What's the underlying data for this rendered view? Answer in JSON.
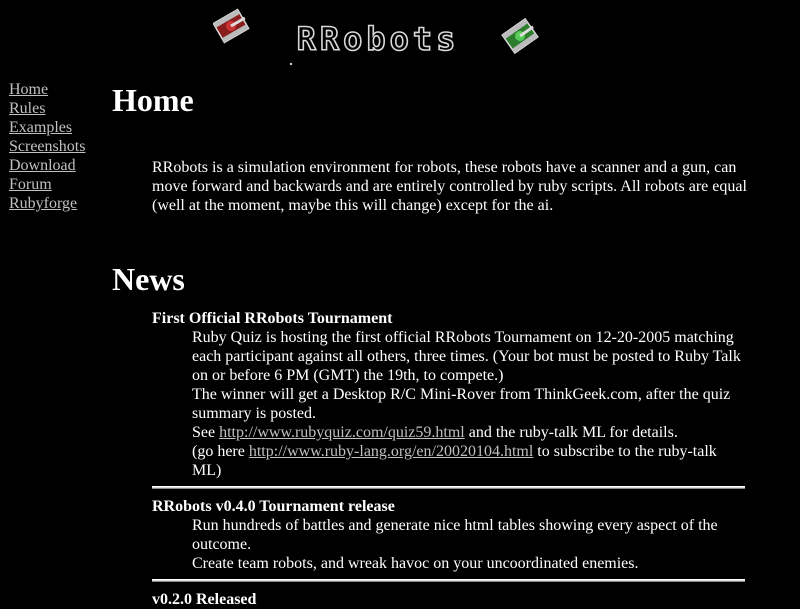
{
  "logo": {
    "text": "RRobots"
  },
  "nav": [
    {
      "label": "Home"
    },
    {
      "label": "Rules"
    },
    {
      "label": "Examples"
    },
    {
      "label": "Screenshots"
    },
    {
      "label": "Download"
    },
    {
      "label": "Forum"
    },
    {
      "label": "Rubyforge"
    }
  ],
  "home": {
    "heading": "Home",
    "intro": "RRobots is a simulation environment for robots, these robots have a scanner and a gun, can move forward and backwards and are entirely controlled by ruby scripts. All robots are equal (well at the moment, maybe this will change) except for the ai."
  },
  "news": {
    "heading": "News",
    "items": [
      {
        "title": "First Official RRobots Tournament",
        "line1": "Ruby Quiz is hosting the first official RRobots Tournament on 12-20-2005 matching each participant against all others, three times. (Your bot must be posted to Ruby Talk on or before 6 PM (GMT) the 19th, to compete.)",
        "line2": "The winner will get a Desktop R/C Mini-Rover from ThinkGeek.com, after the quiz summary is posted.",
        "see_prefix": "See ",
        "see_link": "http://www.rubyquiz.com/quiz59.html",
        "see_suffix": " and the ruby-talk ML for details.",
        "go_prefix": "(go here ",
        "go_link": "http://www.ruby-lang.org/en/20020104.html",
        "go_suffix": " to subscribe to the ruby-talk ML)"
      },
      {
        "title": "RRobots v0.4.0 Tournament release",
        "line1": "Run hundreds of battles and generate nice html tables showing every aspect of the outcome.",
        "line2": "Create team robots, and wreak havoc on your uncoordinated enemies."
      },
      {
        "title": "v0.2.0 Released"
      }
    ]
  }
}
